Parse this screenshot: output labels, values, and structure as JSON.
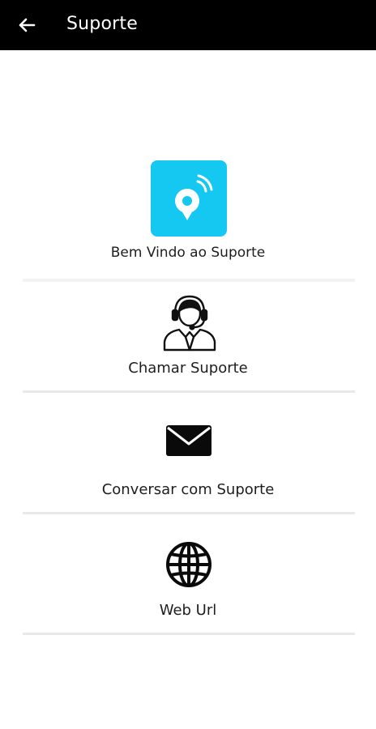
{
  "header": {
    "title": "Suporte",
    "back_icon": "arrow-left-icon"
  },
  "welcome": {
    "label": "Bem Vindo ao Suporte",
    "logo_icon": "support-logo-icon",
    "logo_color": "#14c8f2"
  },
  "items": [
    {
      "label": "Chamar Suporte",
      "icon": "headset-agent-icon"
    },
    {
      "label": "Conversar com Suporte",
      "icon": "envelope-icon"
    },
    {
      "label": "Web Url",
      "icon": "globe-icon"
    }
  ],
  "colors": {
    "app_bar": "#000000",
    "accent": "#14c8f2",
    "divider": "#e9e9e9"
  }
}
